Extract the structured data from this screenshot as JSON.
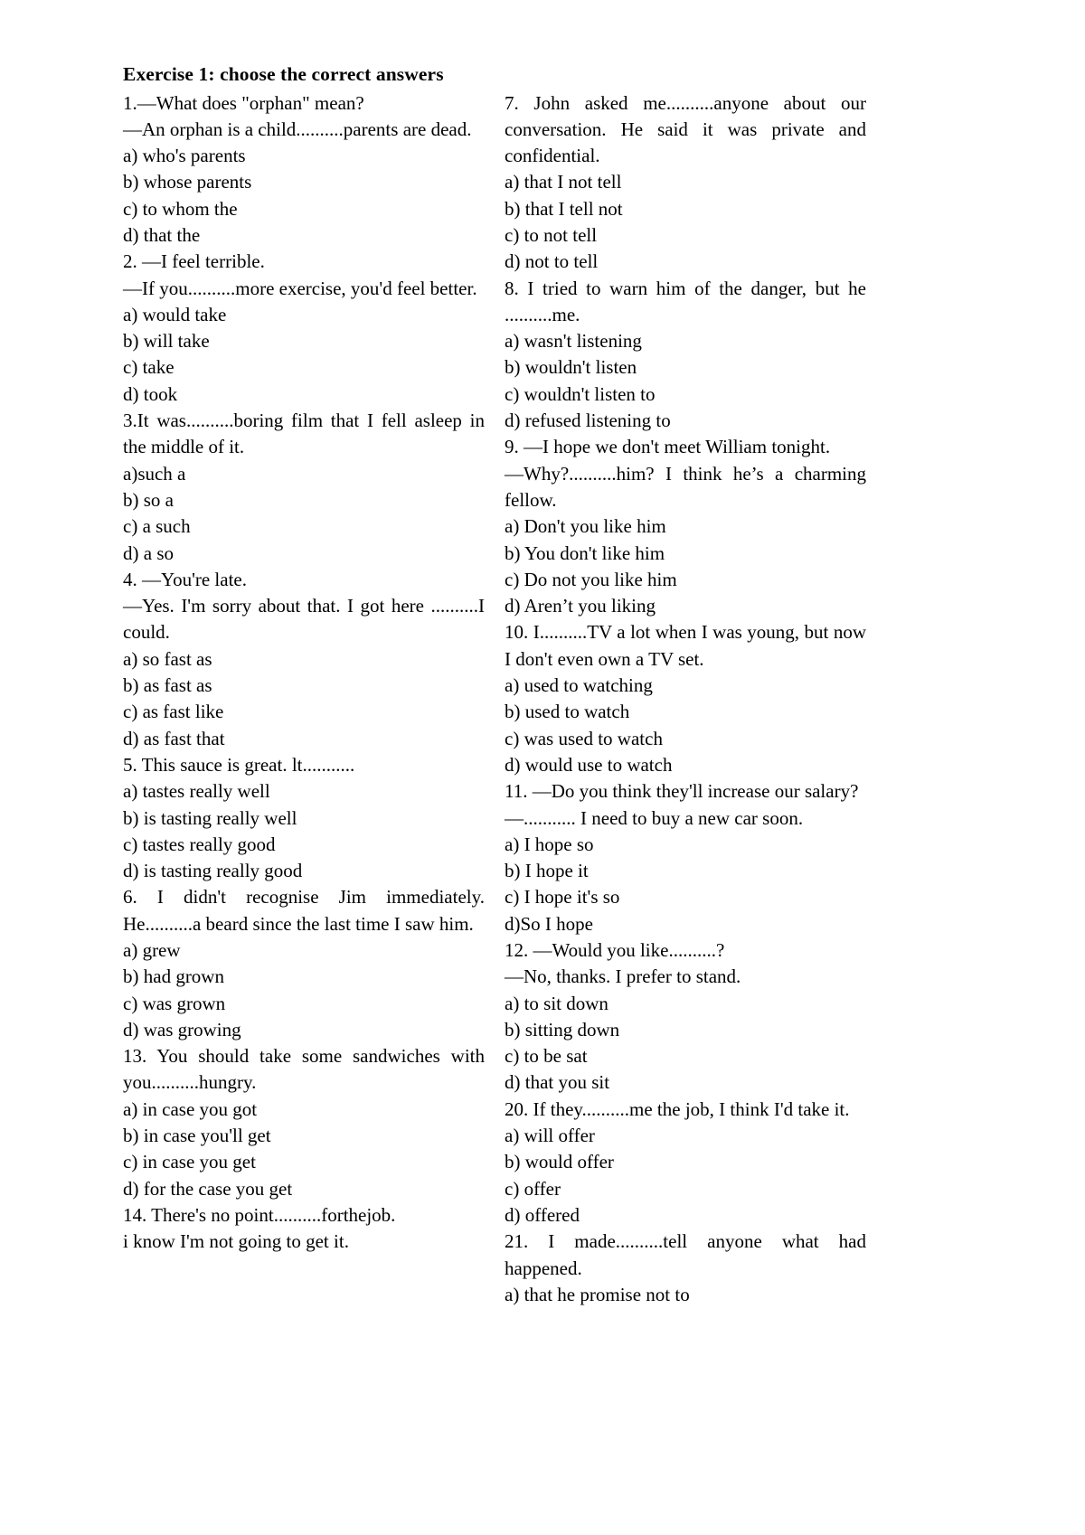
{
  "document": {
    "title": "Exercise 1: choose the correct answers"
  },
  "left_column": [
    {
      "kind": "question",
      "text": "1.—What does \"orphan\" mean?"
    },
    {
      "kind": "question",
      "text": "—An orphan is a child..........parents are dead."
    },
    {
      "kind": "option",
      "text": "a) who's parents"
    },
    {
      "kind": "option",
      "text": "b) whose parents"
    },
    {
      "kind": "option",
      "text": "c) to whom the"
    },
    {
      "kind": "option",
      "text": "d) that the"
    },
    {
      "kind": "question",
      "text": "2. —I feel terrible."
    },
    {
      "kind": "question",
      "text": "—If you..........more exercise, you'd feel better."
    },
    {
      "kind": "option",
      "text": "a) would take"
    },
    {
      "kind": "option",
      "text": "b) will take"
    },
    {
      "kind": "option",
      "text": "c) take"
    },
    {
      "kind": "option",
      "text": "d) took"
    },
    {
      "kind": "question",
      "text": "3.It was..........boring film that I fell asleep in the middle of it."
    },
    {
      "kind": "option",
      "text": "a)such a"
    },
    {
      "kind": "option",
      "text": "b) so a"
    },
    {
      "kind": "option",
      "text": "c) a such"
    },
    {
      "kind": "option",
      "text": "d) a so"
    },
    {
      "kind": "question",
      "text": "4. —You're late."
    },
    {
      "kind": "question",
      "text": "—Yes. I'm sorry about that. I got here ..........I could."
    },
    {
      "kind": "option",
      "text": "a) so fast as"
    },
    {
      "kind": "option",
      "text": "b) as fast as"
    },
    {
      "kind": "option",
      "text": "c) as fast like"
    },
    {
      "kind": "option",
      "text": "d) as fast that"
    },
    {
      "kind": "question",
      "text": "5. This sauce is great. lt..........."
    },
    {
      "kind": "option",
      "text": "a) tastes really well"
    },
    {
      "kind": "option",
      "text": "b) is tasting really well"
    },
    {
      "kind": "option",
      "text": "c) tastes really good"
    },
    {
      "kind": "option",
      "text": "d) is tasting really good"
    },
    {
      "kind": "question",
      "text": "6. I didn't recognise Jim immediately. He..........a beard since the last time I saw him."
    },
    {
      "kind": "option",
      "text": "a) grew"
    },
    {
      "kind": "option",
      "text": "b) had grown"
    },
    {
      "kind": "option",
      "text": "c) was grown"
    },
    {
      "kind": "option",
      "text": "d) was growing"
    },
    {
      "kind": "question",
      "text": "13.    You should take some sandwiches with you..........hungry."
    },
    {
      "kind": "option",
      "text": "a) in case you got"
    },
    {
      "kind": "option",
      "text": "b) in case you'll get"
    },
    {
      "kind": "option",
      "text": "c) in case you get"
    },
    {
      "kind": "option",
      "text": "d) for the case you get"
    },
    {
      "kind": "question",
      "text": "14. There's no point..........forthejob."
    },
    {
      "kind": "question",
      "text": "i know I'm not going to get it."
    }
  ],
  "right_column": [
    {
      "kind": "question",
      "text": "7. John asked me..........anyone about our conversation. He said it was private and confidential."
    },
    {
      "kind": "option",
      "text": "a) that I not tell"
    },
    {
      "kind": "option",
      "text": "b) that I tell not"
    },
    {
      "kind": "option",
      "text": "c) to not tell"
    },
    {
      "kind": "option",
      "text": "d) not to tell"
    },
    {
      "kind": "question",
      "text": "8. I tried to warn him of the danger, but he ..........me."
    },
    {
      "kind": "option",
      "text": "a) wasn't listening"
    },
    {
      "kind": "option",
      "text": "b) wouldn't listen"
    },
    {
      "kind": "option",
      "text": "c) wouldn't listen to"
    },
    {
      "kind": "option",
      "text": "d) refused listening to"
    },
    {
      "kind": "question",
      "text": "9. —I hope we don't meet William tonight."
    },
    {
      "kind": "question",
      "text": "—Why?..........him? I think he’s a charming fellow."
    },
    {
      "kind": "option",
      "text": "a) Don't you like him"
    },
    {
      "kind": "option",
      "text": "b) You don't like him"
    },
    {
      "kind": "option",
      "text": "c) Do not you like him"
    },
    {
      "kind": "option",
      "text": "d) Aren’t you liking"
    },
    {
      "kind": "question",
      "text": "10. I..........TV a lot when I was young, but now I don't even own a TV set."
    },
    {
      "kind": "option",
      "text": "a) used to watching"
    },
    {
      "kind": "option",
      "text": "b) used to watch"
    },
    {
      "kind": "option",
      "text": "c) was used to watch"
    },
    {
      "kind": "option",
      "text": "d) would use to watch"
    },
    {
      "kind": "question",
      "text": "11. —Do you think they'll increase our salary?"
    },
    {
      "kind": "question",
      "text": "—........... I need to buy a new car soon."
    },
    {
      "kind": "option",
      "text": "a) I hope so"
    },
    {
      "kind": "option",
      "text": "b) I hope it"
    },
    {
      "kind": "option",
      "text": "c) I hope it's so"
    },
    {
      "kind": "option",
      "text": "d)So I hope"
    },
    {
      "kind": "question",
      "text": "12. —Would you like..........?"
    },
    {
      "kind": "question",
      "text": "—No, thanks. I prefer to stand."
    },
    {
      "kind": "option",
      "text": "a) to sit down"
    },
    {
      "kind": "option",
      "text": "b) sitting down"
    },
    {
      "kind": "option",
      "text": "c) to be sat"
    },
    {
      "kind": "option",
      "text": "d) that you sit"
    },
    {
      "kind": "question",
      "text": "20. If they..........me the job, I think I'd take it."
    },
    {
      "kind": "option",
      "text": "a) will offer"
    },
    {
      "kind": "option",
      "text": "b) would offer"
    },
    {
      "kind": "option",
      "text": "c) offer"
    },
    {
      "kind": "option",
      "text": "d) offered"
    },
    {
      "kind": "question",
      "text": "21. I made..........tell anyone what had happened."
    },
    {
      "kind": "option",
      "text": "a) that he promise not to"
    }
  ]
}
